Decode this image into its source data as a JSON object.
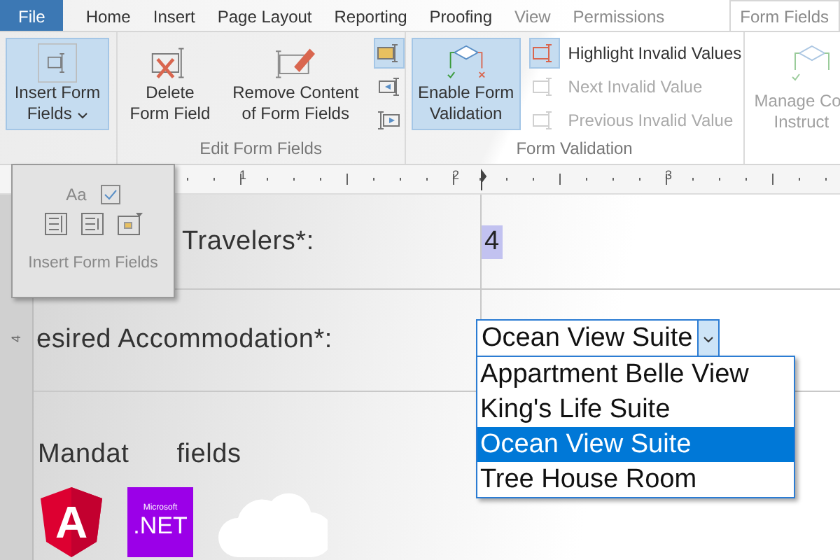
{
  "tabs": [
    {
      "label": "File",
      "kind": "file",
      "selected": false,
      "disabled": false
    },
    {
      "label": "Home",
      "kind": "tab",
      "selected": false,
      "disabled": false
    },
    {
      "label": "Insert",
      "kind": "tab",
      "selected": false,
      "disabled": false
    },
    {
      "label": "Page Layout",
      "kind": "tab",
      "selected": false,
      "disabled": false
    },
    {
      "label": "Reporting",
      "kind": "tab",
      "selected": false,
      "disabled": false
    },
    {
      "label": "Proofing",
      "kind": "tab",
      "selected": false,
      "disabled": false
    },
    {
      "label": "View",
      "kind": "tab",
      "selected": false,
      "disabled": true
    },
    {
      "label": "Permissions",
      "kind": "tab",
      "selected": false,
      "disabled": true
    },
    {
      "label": "Form Fields",
      "kind": "tab",
      "selected": true,
      "disabled": true
    }
  ],
  "ribbon": {
    "insert_button": {
      "lines": [
        "Insert Form",
        "Fields"
      ],
      "pressed": true
    },
    "edit_group": {
      "label": "Edit Form Fields",
      "buttons": [
        {
          "lines": [
            "Delete",
            "Form Field"
          ],
          "kind": "delete"
        },
        {
          "lines": [
            "Remove Content",
            "of Form Fields"
          ],
          "kind": "remove"
        }
      ],
      "small_buttons": [
        {
          "kind": "highlight",
          "pressed": true
        },
        {
          "kind": "prev",
          "pressed": false
        },
        {
          "kind": "next",
          "pressed": false
        }
      ]
    },
    "validation_group": {
      "label": "Form Validation",
      "enable_button": {
        "lines": [
          "Enable Form",
          "Validation"
        ],
        "pressed": true
      },
      "items": [
        {
          "label": "Highlight Invalid Values",
          "pressed": true,
          "disabled": false
        },
        {
          "label": "Next Invalid Value",
          "pressed": false,
          "disabled": true
        },
        {
          "label": "Previous Invalid Value",
          "pressed": false,
          "disabled": true
        }
      ]
    },
    "manage_button": {
      "lines": [
        "Manage Co",
        "Instruct"
      ],
      "disabled": true
    }
  },
  "ruler": {
    "numbers": [
      "1",
      "2",
      "3"
    ],
    "side_number": "4"
  },
  "popup": {
    "title": "Insert Form Fields",
    "text_icon": "Aa"
  },
  "form": {
    "rows": [
      {
        "kind": "text",
        "label": "Travelers*:",
        "value": "4"
      },
      {
        "kind": "dropdown",
        "label": "esired Accommodation*:",
        "value": "Ocean View Suite",
        "expanded": true,
        "options": [
          {
            "label": "Appartment Belle View",
            "selected": false
          },
          {
            "label": "King's Life Suite",
            "selected": false
          },
          {
            "label": "Ocean View Suite",
            "selected": true
          },
          {
            "label": "Tree House Room",
            "selected": false
          }
        ]
      }
    ],
    "note": [
      "Mandat",
      "fields"
    ]
  },
  "logos": [
    {
      "kind": "angular",
      "letter": "A"
    },
    {
      "kind": "dotnet",
      "small": "Microsoft",
      "big": ".NET"
    },
    {
      "kind": "cloud"
    }
  ]
}
